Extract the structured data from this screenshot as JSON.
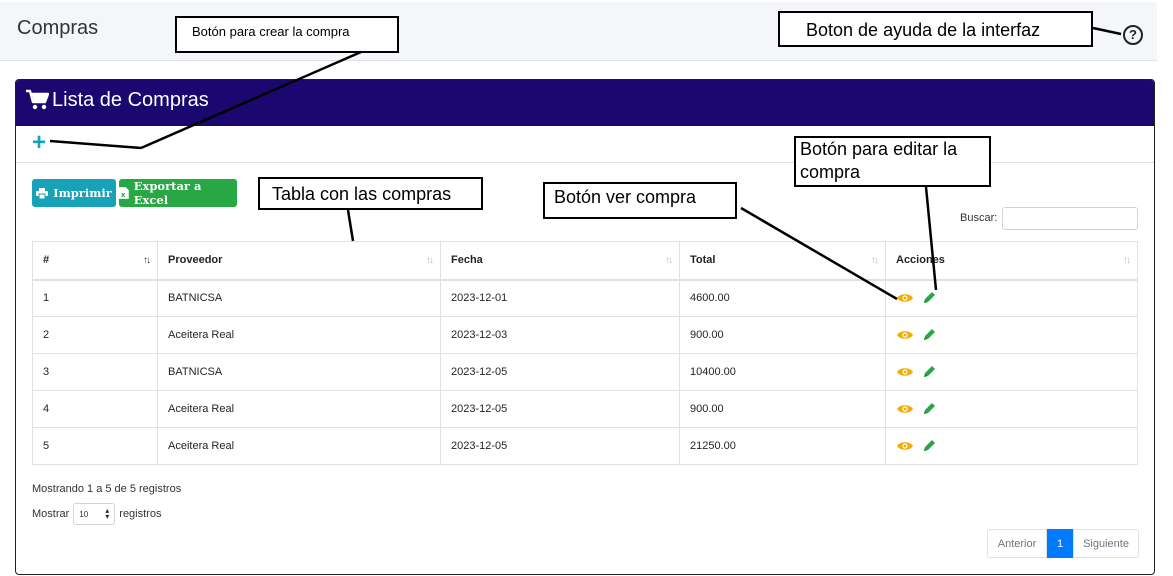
{
  "header": {
    "title": "Compras",
    "help_icon": "question-circle-icon"
  },
  "card": {
    "title": "Lista de Compras",
    "title_icon": "shopping-cart-icon",
    "header_color": "#1a0870",
    "add_label": "+"
  },
  "toolbar": {
    "print_label": "Imprimir",
    "excel_label": "Exportar a Excel",
    "print_color": "#17a2b8",
    "excel_color": "#28a745"
  },
  "search": {
    "label": "Buscar:",
    "value": ""
  },
  "table": {
    "columns": [
      "#",
      "Proveedor",
      "Fecha",
      "Total",
      "Acciones"
    ],
    "rows": [
      [
        "1",
        "BATNICSA",
        "2023-12-01",
        "4600.00"
      ],
      [
        "2",
        "Aceitera Real",
        "2023-12-03",
        "900.00"
      ],
      [
        "3",
        "BATNICSA",
        "2023-12-05",
        "10400.00"
      ],
      [
        "4",
        "Aceitera Real",
        "2023-12-05",
        "900.00"
      ],
      [
        "5",
        "Aceitera Real",
        "2023-12-05",
        "21250.00"
      ]
    ],
    "action_icons": [
      "eye-icon",
      "pencil-icon"
    ],
    "action_colors": {
      "view": "#f0ad00",
      "edit": "#28a745"
    }
  },
  "footer": {
    "info": "Mostrando 1 a 5 de 5 registros",
    "show_label": "Mostrar",
    "page_length": "10",
    "records_label": "registros"
  },
  "pagination": {
    "prev": "Anterior",
    "current": "1",
    "next": "Siguiente"
  },
  "annotations": {
    "create": "Botón para crear la compra",
    "help": "Boton de ayuda de la interfaz",
    "table": "Tabla con las compras",
    "view": "Botón ver compra",
    "edit": "Botón para editar la compra"
  }
}
